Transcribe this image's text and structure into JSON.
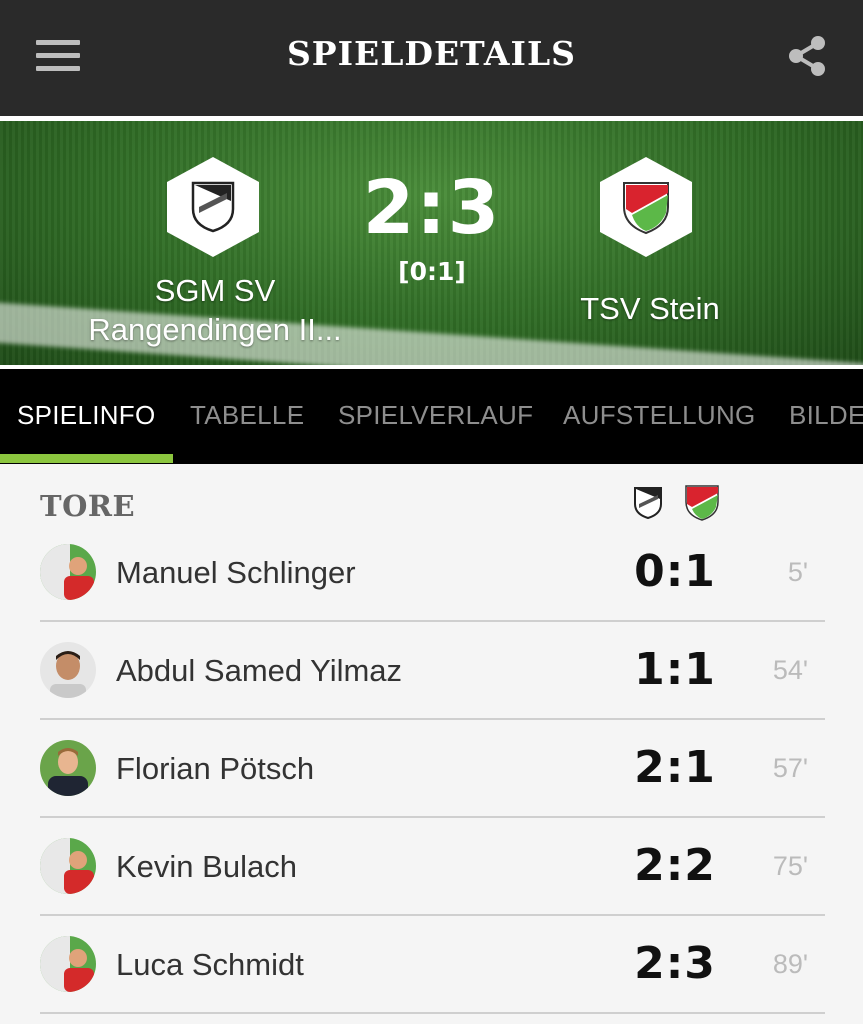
{
  "appbar": {
    "title": "SPIELDETAILS",
    "menu_icon": "hamburger-menu-icon",
    "share_icon": "share-icon"
  },
  "match": {
    "score": "2:3",
    "halftime": "[0:1]",
    "home_team": {
      "name_line1": "SGM SV",
      "name_line2": "Rangendingen II..."
    },
    "away_team": {
      "name": "TSV Stein"
    }
  },
  "tabs": [
    {
      "label": "SPIELINFO",
      "active": true
    },
    {
      "label": "TABELLE"
    },
    {
      "label": "SPIELVERLAUF"
    },
    {
      "label": "AUFSTELLUNG"
    },
    {
      "label": "BILDE"
    }
  ],
  "goals_section": {
    "title": "TORE",
    "rows": [
      {
        "player": "Manuel Schlinger",
        "score": "0:1",
        "minute": "5'"
      },
      {
        "player": "Abdul Samed Yilmaz",
        "score": "1:1",
        "minute": "54'"
      },
      {
        "player": "Florian Pötsch",
        "score": "2:1",
        "minute": "57'"
      },
      {
        "player": "Kevin Bulach",
        "score": "2:2",
        "minute": "75'"
      },
      {
        "player": "Luca Schmidt",
        "score": "2:3",
        "minute": "89'"
      }
    ]
  },
  "colors": {
    "accent": "#8cc63f",
    "appbar": "#2a2a2a",
    "tabs_bg": "#000000"
  }
}
